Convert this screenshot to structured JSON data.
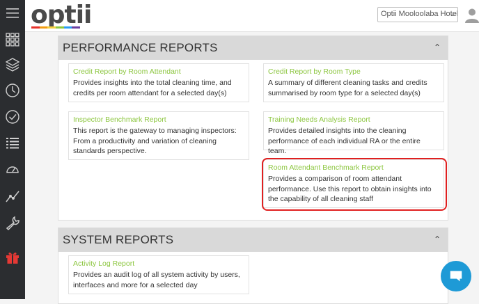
{
  "app": {
    "logo_text": "optii",
    "logo_colors": [
      "#e8322b",
      "#f39c12",
      "#f4d03f",
      "#8cc63f",
      "#2a9df4",
      "#6a3fa0"
    ]
  },
  "header": {
    "hotel_selected": "Optii Mooloolaba Hotel"
  },
  "sidebar": {
    "items": [
      {
        "icon": "hamburger-menu-icon"
      },
      {
        "icon": "grid-icon"
      },
      {
        "icon": "layers-icon"
      },
      {
        "icon": "clock-icon"
      },
      {
        "icon": "check-circle-icon"
      },
      {
        "icon": "list-icon"
      },
      {
        "icon": "dashboard-gauge-icon"
      },
      {
        "icon": "trend-line-icon"
      },
      {
        "icon": "wrench-icon"
      },
      {
        "icon": "gift-icon"
      }
    ]
  },
  "performance_reports": {
    "title": "PERFORMANCE REPORTS",
    "cards": [
      {
        "title": "Credit Report by Room Attendant",
        "description": "Provides insights into the total cleaning time, and credits per room attendant for a selected day(s)"
      },
      {
        "title": "Credit Report by Room Type",
        "description": "A summary of different cleaning tasks and credits summarised by room type for a selected day(s)"
      },
      {
        "title": "Inspector Benchmark Report",
        "description": "This report is the gateway to managing inspectors: From a productivity and variation of cleaning standards perspective."
      },
      {
        "title": "Training Needs Analysis Report",
        "description": "Provides detailed insights into the cleaning performance of each individual RA or the entire team."
      },
      {
        "title": "Room Attendant Benchmark Report",
        "description": "Provides a comparison of room attendant performance. Use this report to obtain insights into the capability of all cleaning staff"
      }
    ]
  },
  "system_reports": {
    "title": "SYSTEM REPORTS",
    "cards": [
      {
        "title": "Activity Log Report",
        "description": "Provides an audit log of all system activity by users, interfaces and more for a selected day"
      }
    ]
  },
  "colors": {
    "link_green": "#8cc63f",
    "sidebar_bg": "#2b2d30",
    "highlight_red": "#e02020",
    "chat_blue": "#1e9ad6",
    "gift_red": "#e53935"
  }
}
